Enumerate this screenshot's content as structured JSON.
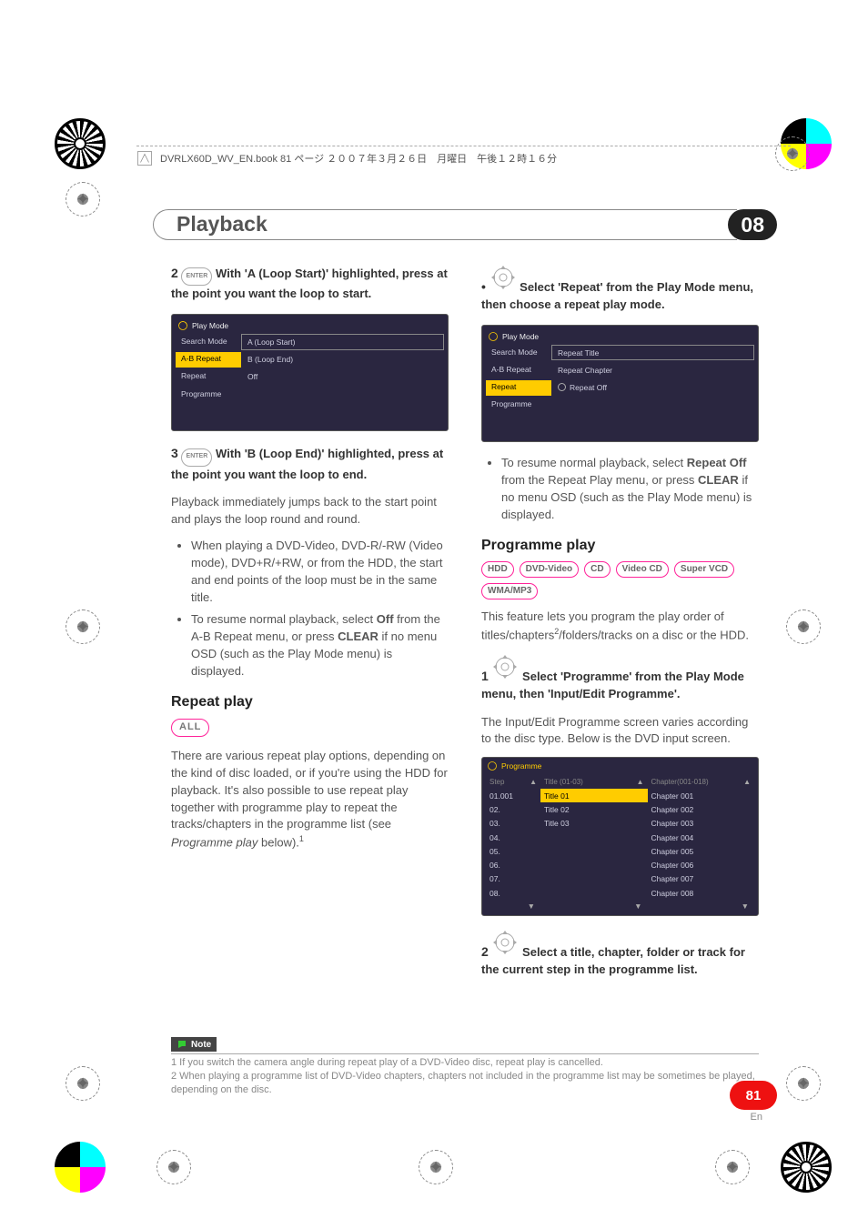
{
  "header_meta": "DVRLX60D_WV_EN.book  81 ページ  ２００７年３月２６日　月曜日　午後１２時１６分",
  "section": {
    "title": "Playback",
    "number": "08"
  },
  "page": {
    "number": "81",
    "lang": "En"
  },
  "col1": {
    "step2": {
      "num": "2",
      "btn": "ENTER",
      "text_bold": "With 'A (Loop Start)' highlighted, press at the point you want the loop to start."
    },
    "menu2": {
      "title": "Play Mode",
      "rows": [
        {
          "left": "Search Mode",
          "right": "A (Loop Start)",
          "boxed": true
        },
        {
          "left": "A-B Repeat",
          "right": "B (Loop End)",
          "hl": true
        },
        {
          "left": "Repeat",
          "right": "Off"
        },
        {
          "left": "Programme",
          "right": ""
        }
      ]
    },
    "step3": {
      "num": "3",
      "btn": "ENTER",
      "text_bold": "With 'B (Loop End)' highlighted, press at the point you want the loop to end."
    },
    "step3_body": "Playback immediately jumps back to the start point and plays the loop round and round.",
    "bullets3": [
      "When playing a DVD-Video, DVD-R/-RW (Video mode), DVD+R/+RW, or from the HDD, the start and end points of the loop must be in the same title.",
      "To resume normal playback, select Off from the A-B Repeat menu, or press CLEAR if no menu OSD (such as the Play Mode menu) is displayed."
    ],
    "repeat_heading": "Repeat play",
    "all_pill": "ALL",
    "repeat_body_a": "There are various repeat play options, depending on the kind of disc loaded, or if you're using the HDD for playback. It's also possible to use repeat play together with programme play to repeat the tracks/chapters in the programme list (see ",
    "repeat_body_i": "Programme play",
    "repeat_body_b": " below).",
    "repeat_sup": "1"
  },
  "col2": {
    "step_dot": {
      "num": "•",
      "text_bold": "Select 'Repeat' from the Play Mode menu, then choose a repeat play mode."
    },
    "menu_repeat": {
      "title": "Play Mode",
      "rows": [
        {
          "left": "Search Mode",
          "right": "Repeat Title",
          "boxed": true
        },
        {
          "left": "A-B Repeat",
          "right": "Repeat Chapter"
        },
        {
          "left": "Repeat",
          "right": "Repeat Off",
          "hl": true,
          "radio": true
        },
        {
          "left": "Programme",
          "right": ""
        }
      ]
    },
    "bullet_resume": "To resume normal playback, select Repeat Off from the Repeat Play menu, or press CLEAR if no menu OSD (such as the Play Mode menu) is displayed.",
    "prog_heading": "Programme play",
    "formats": [
      "HDD",
      "DVD-Video",
      "CD",
      "Video CD",
      "Super VCD",
      "WMA/MP3"
    ],
    "prog_intro_a": "This feature lets you program the play order of titles/chapters",
    "prog_sup": "2",
    "prog_intro_b": "/folders/tracks on a disc or the HDD.",
    "step1": {
      "num": "1",
      "text_bold": "Select 'Programme' from the Play Mode menu, then 'Input/Edit Programme'."
    },
    "step1_body": "The Input/Edit Programme screen varies according to the disc type. Below is the DVD input screen.",
    "prog_table": {
      "title": "Programme",
      "headers": [
        "Step",
        "Title (01-03)",
        "Chapter(001-018)"
      ],
      "steps": [
        "01.001",
        "02.",
        "03.",
        "04.",
        "05.",
        "06.",
        "07.",
        "08."
      ],
      "titles": [
        "Title 01",
        "Title 02",
        "Title 03",
        "",
        "",
        "",
        "",
        ""
      ],
      "chapters": [
        "Chapter 001",
        "Chapter 002",
        "Chapter 003",
        "Chapter 004",
        "Chapter 005",
        "Chapter 006",
        "Chapter 007",
        "Chapter 008"
      ]
    },
    "step2b": {
      "num": "2",
      "text_bold": "Select a title, chapter, folder or track for the current step in the programme list."
    }
  },
  "notes": {
    "label": "Note",
    "n1": "1 If you switch the camera angle during repeat play of a DVD-Video disc, repeat play is cancelled.",
    "n2": "2 When playing a programme list of DVD-Video chapters, chapters not included in the programme list may be sometimes be played, depending on the disc."
  }
}
